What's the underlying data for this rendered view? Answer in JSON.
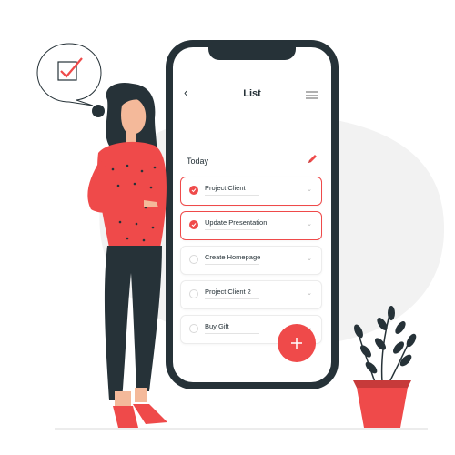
{
  "app": {
    "title": "List",
    "back_icon": "chevron-left-icon",
    "menu_icon": "hamburger-menu-icon"
  },
  "section": {
    "label": "Today",
    "edit_icon": "pencil-icon"
  },
  "tasks": [
    {
      "label": "Project Client",
      "done": true
    },
    {
      "label": "Update Presentation",
      "done": true
    },
    {
      "label": "Create Homepage",
      "done": false
    },
    {
      "label": "Project Client 2",
      "done": false
    },
    {
      "label": "Buy Gift",
      "done": false
    }
  ],
  "fab": {
    "icon": "plus-icon"
  },
  "bubble": {
    "icon": "checkbox-checked-icon"
  },
  "colors": {
    "accent": "#ef4a4a",
    "dark": "#263238",
    "blob": "#f2f2f2"
  }
}
